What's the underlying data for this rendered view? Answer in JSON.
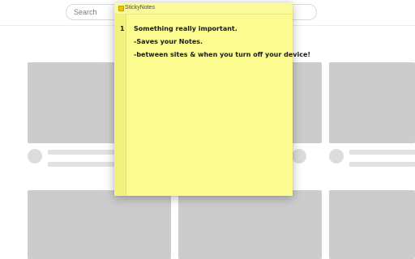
{
  "browser_page": {
    "search": {
      "placeholder": "Search"
    }
  },
  "sticky_notes": {
    "app_title": "StickyNotes",
    "logo_icon": "sticky-note-icon",
    "colors": {
      "note_background": "#fbfb8f",
      "gutter": "#f1f17e"
    },
    "line_number": "1",
    "lines": [
      "Something really important.",
      "-Saves your Notes.",
      "-between sites & when you turn off your device!"
    ]
  }
}
